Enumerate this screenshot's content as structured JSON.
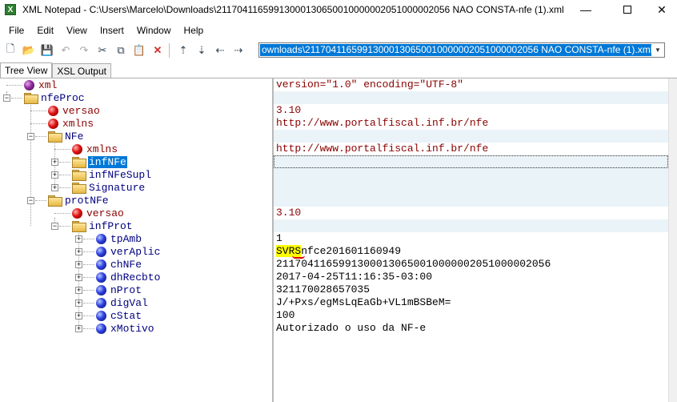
{
  "window": {
    "title": "XML Notepad - C:\\Users\\Marcelo\\Downloads\\21170411659913000130650010000002051000002056 NAO CONSTA-nfe (1).xml",
    "app_icon": "X",
    "minimize": "—",
    "close": "✕"
  },
  "menu": [
    "File",
    "Edit",
    "View",
    "Insert",
    "Window",
    "Help"
  ],
  "toolbar": {
    "icons": [
      "new-file-icon",
      "open-folder-icon",
      "save-icon",
      "undo-icon",
      "redo-icon",
      "cut-icon",
      "copy-icon",
      "paste-icon",
      "delete-icon",
      "nudge-up-icon",
      "nudge-down-icon",
      "nudge-left-icon",
      "nudge-right-icon"
    ],
    "location": "ownloads\\21170411659913000130650010000002051000002056 NAO CONSTA-nfe (1).xml"
  },
  "tabs": [
    "Tree View",
    "XSL Output"
  ],
  "tree": {
    "nodes": [
      {
        "label": "xml",
        "kind": "pi"
      },
      {
        "label": "nfeProc",
        "kind": "folder"
      },
      {
        "label": "versao",
        "kind": "attr"
      },
      {
        "label": "xmlns",
        "kind": "attr"
      },
      {
        "label": "NFe",
        "kind": "folder"
      },
      {
        "label": "xmlns",
        "kind": "attr"
      },
      {
        "label": "infNFe",
        "kind": "folder",
        "selected": true
      },
      {
        "label": "infNFeSupl",
        "kind": "folder"
      },
      {
        "label": "Signature",
        "kind": "folder"
      },
      {
        "label": "protNFe",
        "kind": "folder"
      },
      {
        "label": "versao",
        "kind": "attr"
      },
      {
        "label": "infProt",
        "kind": "folder"
      },
      {
        "label": "tpAmb",
        "kind": "elem"
      },
      {
        "label": "verAplic",
        "kind": "elem"
      },
      {
        "label": "chNFe",
        "kind": "elem"
      },
      {
        "label": "dhRecbto",
        "kind": "elem"
      },
      {
        "label": "nProt",
        "kind": "elem"
      },
      {
        "label": "digVal",
        "kind": "elem"
      },
      {
        "label": "cStat",
        "kind": "elem"
      },
      {
        "label": "xMotivo",
        "kind": "elem"
      }
    ]
  },
  "values": {
    "xml": "version=\"1.0\" encoding=\"UTF-8\"",
    "nfeProc_versao": "3.10",
    "nfeProc_xmlns": "http://www.portalfiscal.inf.br/nfe",
    "nfe_xmlns": "http://www.portalfiscal.inf.br/nfe",
    "protNFe_versao": "3.10",
    "tpAmb": "1",
    "verAplic_highlight": "SVRS",
    "verAplic_rest": "nfce201601160949",
    "chNFe": "21170411659913000130650010000002051000002056",
    "dhRecbto": "2017-04-25T11:16:35-03:00",
    "nProt": "321170028657035",
    "digVal": "J/+Pxs/egMsLqEaGb+VL1mBSBeM=",
    "cStat": "100",
    "xMotivo": "Autorizado o uso da NF-e"
  }
}
